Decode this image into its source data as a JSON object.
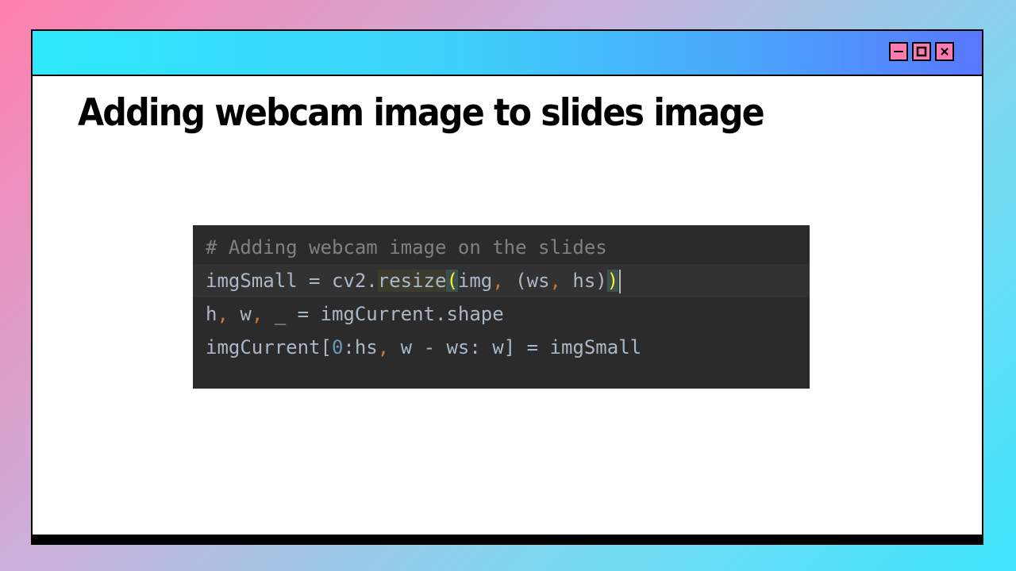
{
  "window": {
    "title_bar": {
      "controls": [
        {
          "name": "minimize",
          "icon": "minimize-icon"
        },
        {
          "name": "maximize",
          "icon": "maximize-icon"
        },
        {
          "name": "close",
          "icon": "close-icon"
        }
      ]
    }
  },
  "slide": {
    "title": "Adding webcam image to slides image"
  },
  "code": {
    "line1": {
      "comment": "# Adding webcam image on the slides"
    },
    "line2": {
      "var": "imgSmall = cv2.",
      "func": "resize",
      "open": "(",
      "arg1": "img",
      "comma1": ",",
      "tuple_open": " (ws",
      "comma2": ",",
      "tuple_close": " hs)",
      "close": ")"
    },
    "line3": {
      "a": "h",
      "comma1": ",",
      "b": " w",
      "comma2": ",",
      "c": " _ = imgCurrent.shape"
    },
    "line4": {
      "a": "imgCurrent[",
      "num": "0",
      "b": ":hs",
      "comma": ",",
      "c": " w - ws: w] = imgSmall"
    }
  },
  "colors": {
    "code_bg": "#2b2b2b",
    "code_text": "#a9b7c6",
    "comment": "#808080",
    "punctuation": "#cc7832",
    "number": "#6897bb",
    "paren_highlight": "#ffef28",
    "control_button": "#ff7ab0"
  }
}
